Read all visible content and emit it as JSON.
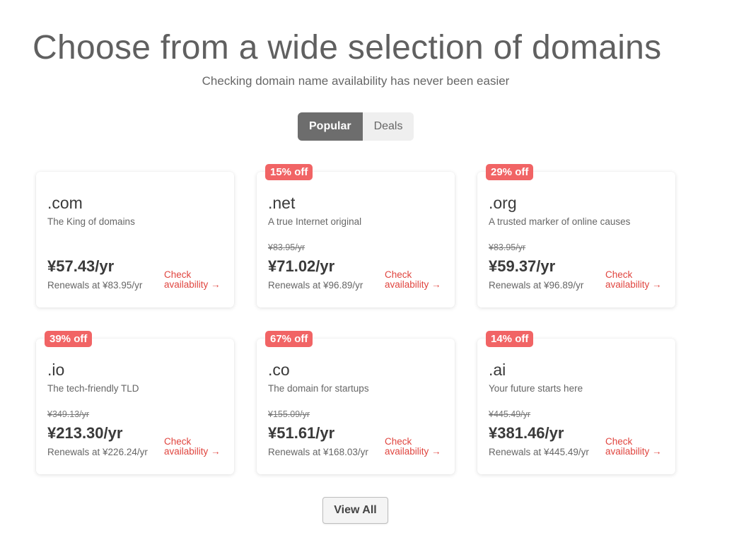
{
  "header": {
    "title": "Choose from a wide selection of domains",
    "subtitle": "Checking domain name availability has never been easier"
  },
  "tabs": [
    {
      "label": "Popular",
      "active": true
    },
    {
      "label": "Deals",
      "active": false
    }
  ],
  "cards": [
    {
      "badge": "",
      "tld": ".com",
      "tagline": "The King of domains",
      "old_price": "",
      "price": "¥57.43/yr",
      "renewal": "Renewals at ¥83.95/yr",
      "cta": "Check availability →"
    },
    {
      "badge": "15% off",
      "tld": ".net",
      "tagline": "A true Internet original",
      "old_price": "¥83.95/yr",
      "price": "¥71.02/yr",
      "renewal": "Renewals at ¥96.89/yr",
      "cta": "Check availability →"
    },
    {
      "badge": "29% off",
      "tld": ".org",
      "tagline": "A trusted marker of online causes",
      "old_price": "¥83.95/yr",
      "price": "¥59.37/yr",
      "renewal": "Renewals at ¥96.89/yr",
      "cta": "Check availability →"
    },
    {
      "badge": "39% off",
      "tld": ".io",
      "tagline": "The tech-friendly TLD",
      "old_price": "¥349.13/yr",
      "price": "¥213.30/yr",
      "renewal": "Renewals at ¥226.24/yr",
      "cta": "Check availability →"
    },
    {
      "badge": "67% off",
      "tld": ".co",
      "tagline": "The domain for startups",
      "old_price": "¥155.09/yr",
      "price": "¥51.61/yr",
      "renewal": "Renewals at ¥168.03/yr",
      "cta": "Check availability →"
    },
    {
      "badge": "14% off",
      "tld": ".ai",
      "tagline": "Your future starts here",
      "old_price": "¥445.49/yr",
      "price": "¥381.46/yr",
      "renewal": "Renewals at ¥445.49/yr",
      "cta": "Check availability →"
    }
  ],
  "footer": {
    "view_all_label": "View All"
  },
  "colors": {
    "accent": "#e0453f",
    "badge": "#f16465",
    "active_tab": "#6d6d6d"
  }
}
